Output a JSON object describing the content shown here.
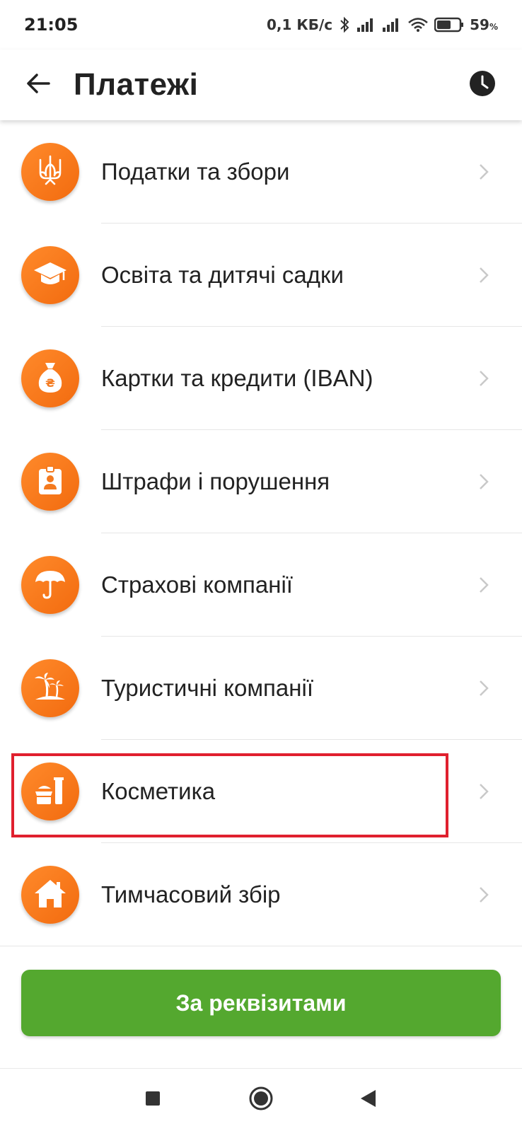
{
  "status_bar": {
    "time": "21:05",
    "network_speed": "0,1 КБ/с",
    "battery_percent": "59",
    "battery_unit": "%",
    "icons": [
      "bluetooth-icon",
      "signal-icon",
      "signal-icon",
      "wifi-icon",
      "battery-icon"
    ]
  },
  "header": {
    "title": "Платежі",
    "back_icon": "arrow-left-icon",
    "history_icon": "clock-icon"
  },
  "categories": [
    {
      "label": "Податки та збори",
      "icon": "trident-icon"
    },
    {
      "label": "Освіта та дитячі садки",
      "icon": "graduation-cap-icon"
    },
    {
      "label": "Картки та кредити (IBAN)",
      "icon": "money-bag-icon"
    },
    {
      "label": "Штрафи і порушення",
      "icon": "id-badge-icon"
    },
    {
      "label": "Страхові компанії",
      "icon": "umbrella-icon"
    },
    {
      "label": "Туристичні компанії",
      "icon": "palm-island-icon"
    },
    {
      "label": "Косметика",
      "icon": "cosmetics-icon",
      "highlighted": true
    },
    {
      "label": "Тимчасовий збір",
      "icon": "house-icon"
    }
  ],
  "primary_button": {
    "label": "За реквізитами"
  },
  "colors": {
    "accent_orange": "#f47a1f",
    "button_green": "#54a82f",
    "highlight_red": "#e0202e"
  },
  "nav": {
    "icons": [
      "recent-apps-icon",
      "home-icon",
      "back-triangle-icon"
    ]
  }
}
